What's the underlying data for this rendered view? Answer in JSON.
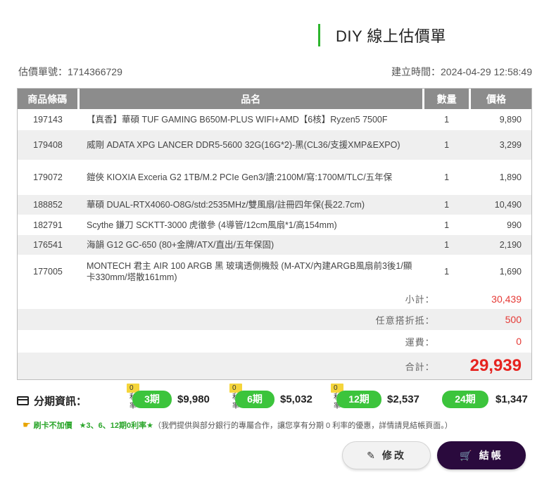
{
  "header": {
    "title": "DIY 線上估價單"
  },
  "meta": {
    "quote_no": "估價單號：1714366729",
    "created": "建立時間：2024-04-29 12:58:49"
  },
  "table": {
    "columns": {
      "code": "商品條碼",
      "name": "品名",
      "qty": "數量",
      "price": "價格"
    },
    "rows": [
      {
        "code": "197143",
        "name": "【真香】華碩 TUF GAMING B650M-PLUS WIFI+AMD【6核】Ryzen5 7500F",
        "qty": "1",
        "price": "9,890"
      },
      {
        "code": "179408",
        "name": "威剛 ADATA XPG LANCER DDR5-5600 32G(16G*2)-黑(CL36/支援XMP&EXPO)",
        "qty": "1",
        "price": "3,299"
      },
      {
        "code": "179072",
        "name": "鎧俠 KIOXIA Exceria G2 1TB/M.2 PCIe Gen3/讀:2100M/寫:1700M/TLC/五年保",
        "qty": "1",
        "price": "1,890"
      },
      {
        "code": "188852",
        "name": "華碩 DUAL-RTX4060-O8G/std:2535MHz/雙風扇/註冊四年保(長22.7cm)",
        "qty": "1",
        "price": "10,490"
      },
      {
        "code": "182791",
        "name": "Scythe 鎌刀 SCKTT-3000 虎徹參 (4導管/12cm風扇*1/高154mm)",
        "qty": "1",
        "price": "990"
      },
      {
        "code": "176541",
        "name": "海韻 G12 GC-650 (80+金牌/ATX/直出/五年保固)",
        "qty": "1",
        "price": "2,190"
      },
      {
        "code": "177005",
        "name": "MONTECH 君主 AIR 100 ARGB 黑 玻璃透側機殼 (M-ATX/內建ARGB風扇前3後1/顯卡330mm/塔散161mm)",
        "qty": "1",
        "price": "1,690"
      }
    ]
  },
  "summary": {
    "subtotal_label": "小計：",
    "subtotal": "30,439",
    "discount_label": "任意搭折抵：",
    "discount": "500",
    "shipping_label": "運費：",
    "shipping": "0",
    "total_label": "合計：",
    "total": "29,939"
  },
  "installments": {
    "label": "分期資訊：",
    "zero_tag": "0利率",
    "plans": [
      {
        "term": "3期",
        "amount": "$9,980",
        "zero": true
      },
      {
        "term": "6期",
        "amount": "$5,032",
        "zero": true
      },
      {
        "term": "12期",
        "amount": "$2,537",
        "zero": true
      },
      {
        "term": "24期",
        "amount": "$1,347",
        "zero": false
      }
    ]
  },
  "notice": {
    "strong": "刷卡不加價",
    "rate": "★3、6、12期0利率★",
    "text": "（我們提供與部分銀行的專屬合作，讓您享有分期 0 利率的優惠，詳情請見結帳頁面。）"
  },
  "buttons": {
    "edit": "修改",
    "checkout": "結帳"
  },
  "colors": {
    "accent_green": "#3cc43c",
    "price_red": "#e53935",
    "checkout_bg": "#2a0a3d"
  }
}
